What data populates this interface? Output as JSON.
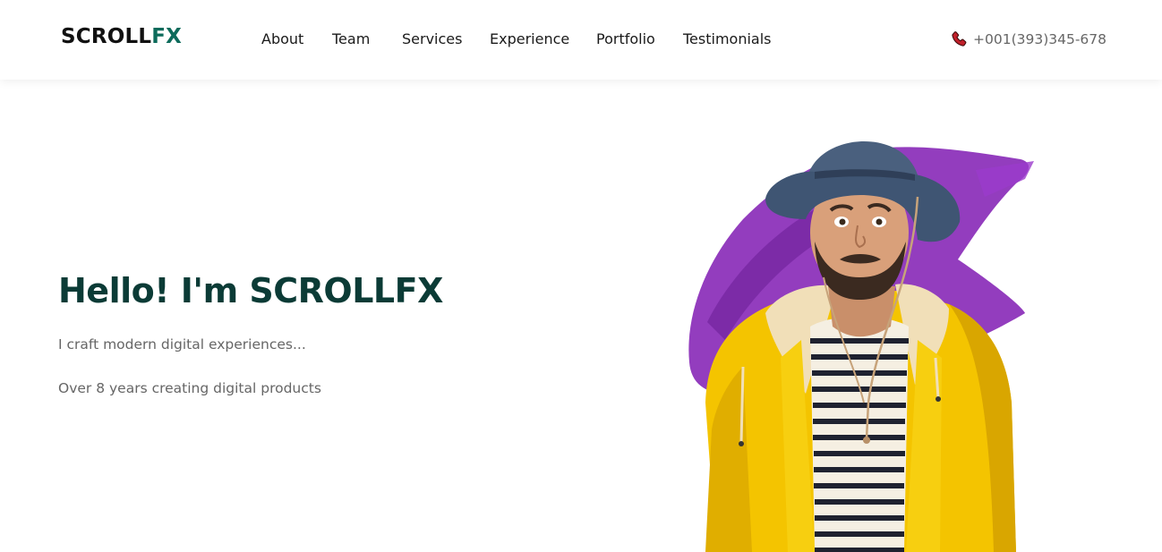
{
  "brand": {
    "logo_main": "SCROLL",
    "logo_accent": "FX",
    "accent_color": "#0d6b5b"
  },
  "nav": {
    "items": [
      {
        "label": "About"
      },
      {
        "label": "Team"
      },
      {
        "label": "Services"
      },
      {
        "label": "Experience"
      },
      {
        "label": "Portfolio"
      },
      {
        "label": "Testimonials"
      }
    ]
  },
  "contact": {
    "phone": "+001(393)345-678",
    "icon": "phone-icon",
    "icon_color": "#c0202a"
  },
  "hero": {
    "title": "Hello! I'm SCROLLFX",
    "subtitle": "I craft modern digital experiences...",
    "tagline": "Over 8 years creating digital products",
    "title_color": "#0b3b36",
    "image": "man-in-yellow-raincoat-photo",
    "brush_color": "#8a2db8"
  }
}
